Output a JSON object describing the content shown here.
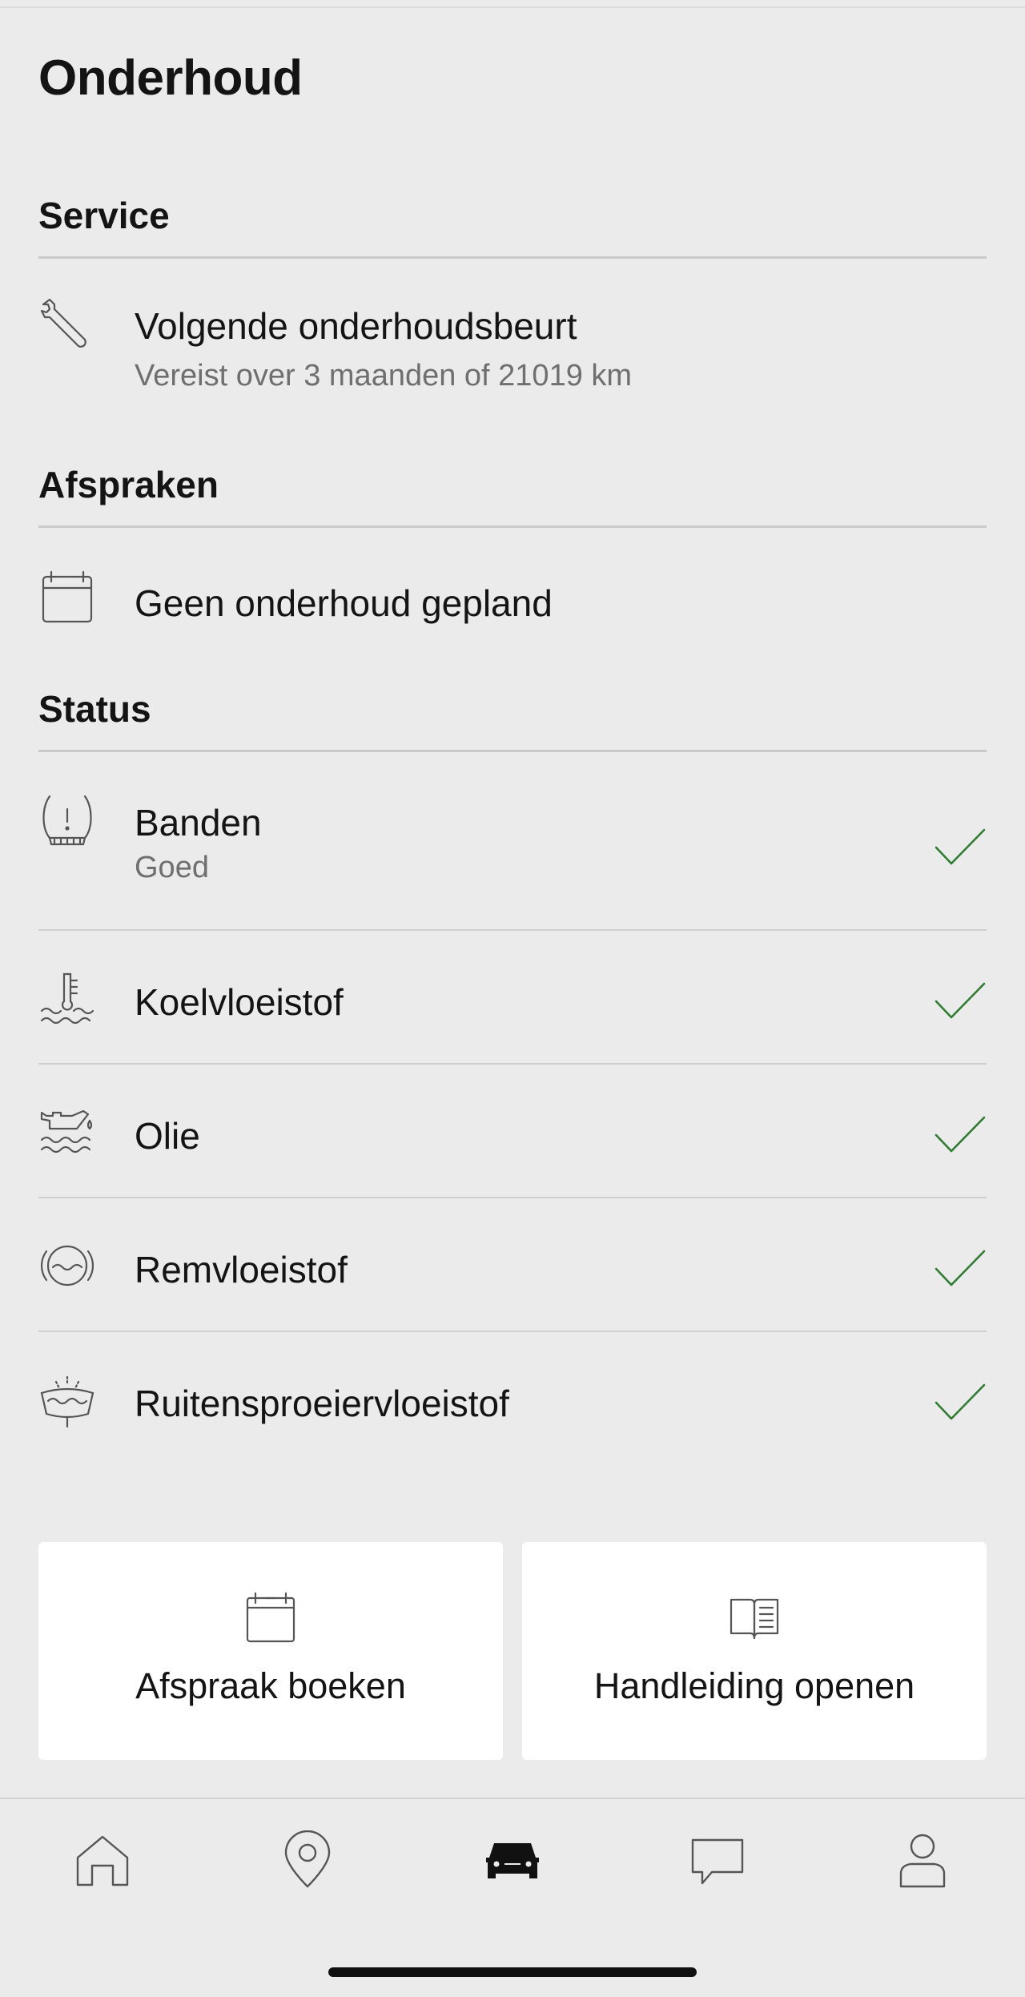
{
  "page": {
    "title": "Onderhoud"
  },
  "service": {
    "header": "Service",
    "item": {
      "icon": "wrench-icon",
      "title": "Volgende onderhoudsbeurt",
      "subtitle": "Vereist over 3 maanden of 21019 km"
    }
  },
  "appointments": {
    "header": "Afspraken",
    "item": {
      "icon": "calendar-icon",
      "title": "Geen onderhoud gepland"
    }
  },
  "status": {
    "header": "Status",
    "items": [
      {
        "icon": "tire-pressure-icon",
        "title": "Banden",
        "subtitle": "Goed",
        "state": "ok"
      },
      {
        "icon": "coolant-icon",
        "title": "Koelvloeistof",
        "state": "ok"
      },
      {
        "icon": "oil-can-icon",
        "title": "Olie",
        "state": "ok"
      },
      {
        "icon": "brake-fluid-icon",
        "title": "Remvloeistof",
        "state": "ok"
      },
      {
        "icon": "washer-fluid-icon",
        "title": "Ruitensproeiervloeistof",
        "state": "ok"
      }
    ]
  },
  "actions": {
    "book": {
      "icon": "calendar-icon",
      "label": "Afspraak boeken"
    },
    "manual": {
      "icon": "book-icon",
      "label": "Handleiding openen"
    }
  },
  "tabbar": {
    "items": [
      {
        "icon": "home-icon",
        "active": false
      },
      {
        "icon": "location-pin-icon",
        "active": false
      },
      {
        "icon": "car-icon",
        "active": true
      },
      {
        "icon": "chat-icon",
        "active": false
      },
      {
        "icon": "profile-icon",
        "active": false
      }
    ]
  },
  "colors": {
    "background": "#ebebeb",
    "card": "#ffffff",
    "text": "#141414",
    "subtext": "#6f6f6f",
    "check": "#2e7d32",
    "icon": "#555555"
  }
}
